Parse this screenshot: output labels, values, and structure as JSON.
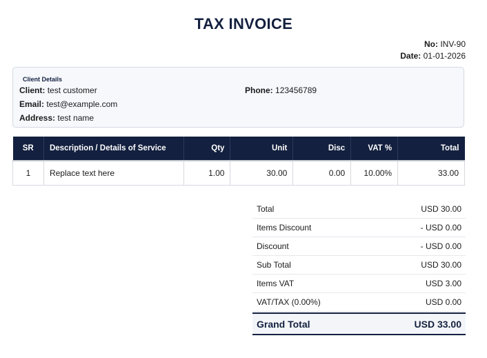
{
  "invoice": {
    "title": "TAX INVOICE",
    "no_label": "No:",
    "no_value": "INV-90",
    "date_label": "Date:",
    "date_value": "01-01-2026"
  },
  "client": {
    "heading": "Client Details",
    "client_label": "Client:",
    "client_value": "test customer",
    "phone_label": "Phone:",
    "phone_value": "123456789",
    "email_label": "Email:",
    "email_value": "test@example.com",
    "address_label": "Address:",
    "address_value": "test name"
  },
  "items_table": {
    "headers": [
      "SR",
      "Description / Details of Service",
      "Qty",
      "Unit",
      "Disc",
      "VAT %",
      "Total"
    ],
    "rows": [
      [
        "1",
        "Replace text here",
        "1.00",
        "30.00",
        "0.00",
        "10.00%",
        "33.00"
      ]
    ]
  },
  "totals": {
    "rows": [
      {
        "label": "Total",
        "value": "USD 30.00"
      },
      {
        "label": "Items Discount",
        "value": "- USD 0.00"
      },
      {
        "label": "Discount",
        "value": "- USD 0.00"
      },
      {
        "label": "Sub Total",
        "value": "USD 30.00"
      },
      {
        "label": "Items VAT",
        "value": "USD 3.00"
      },
      {
        "label": "VAT/TAX (0.00%)",
        "value": "USD 0.00"
      }
    ],
    "grand_label": "Grand Total",
    "grand_value": "USD 33.00"
  },
  "colors": {
    "header_navy": "#13203f",
    "panel_bg": "#f6f8fc",
    "border": "#d6d9de"
  }
}
